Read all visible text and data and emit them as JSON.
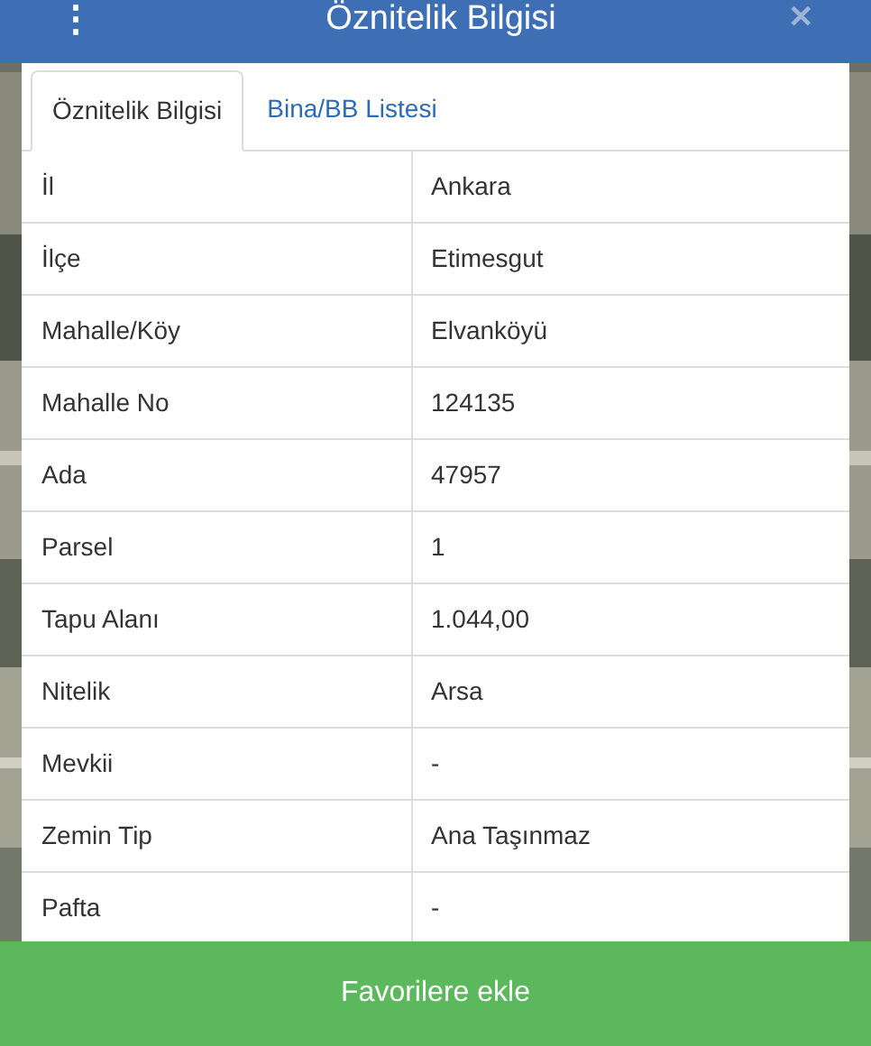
{
  "header": {
    "title": "Öznitelik Bilgisi",
    "menu_icon": "⋮",
    "close_icon": "✕"
  },
  "tabs": [
    {
      "label": "Öznitelik Bilgisi",
      "selected": true
    },
    {
      "label": "Bina/BB Listesi",
      "selected": false
    }
  ],
  "table": {
    "rows": [
      {
        "label": "İl",
        "value": "Ankara"
      },
      {
        "label": "İlçe",
        "value": "Etimesgut"
      },
      {
        "label": "Mahalle/Köy",
        "value": "Elvanköyü"
      },
      {
        "label": "Mahalle No",
        "value": "124135"
      },
      {
        "label": "Ada",
        "value": "47957"
      },
      {
        "label": "Parsel",
        "value": "1"
      },
      {
        "label": "Tapu Alanı",
        "value": "1.044,00"
      },
      {
        "label": "Nitelik",
        "value": "Arsa"
      },
      {
        "label": "Mevkii",
        "value": "-"
      },
      {
        "label": "Zemin Tip",
        "value": "Ana Taşınmaz"
      },
      {
        "label": "Pafta",
        "value": "-"
      }
    ]
  },
  "button": "Favorilere ekle"
}
